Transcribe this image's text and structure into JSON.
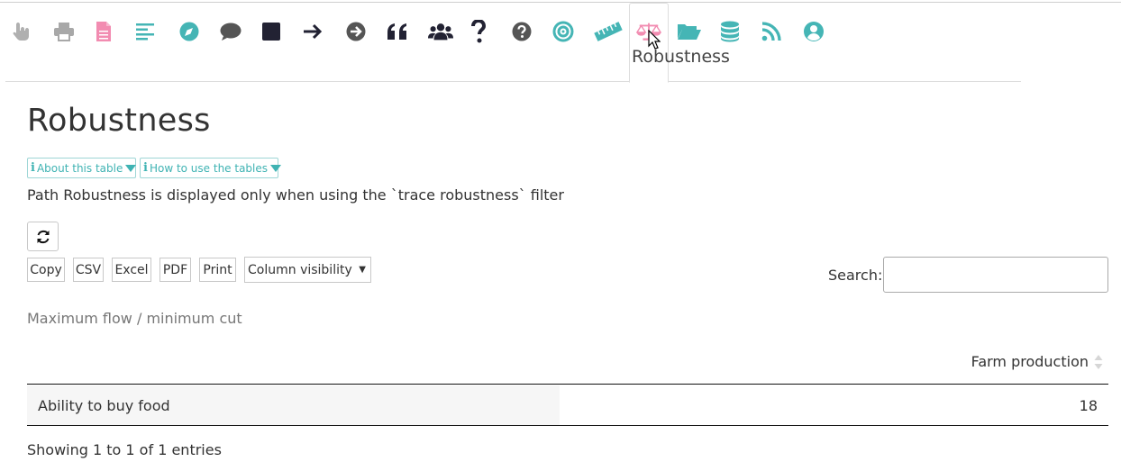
{
  "toolbar": {
    "icons": [
      {
        "name": "hand-pointer-icon",
        "color": "#b0b0b0"
      },
      {
        "name": "print-icon",
        "color": "#a8a8a8"
      },
      {
        "name": "file-icon",
        "color": "#f28cb1"
      },
      {
        "name": "align-left-icon",
        "color": "#45b5b5"
      },
      {
        "name": "compass-icon",
        "color": "#45b5b5"
      },
      {
        "name": "comment-icon",
        "color": "#555555"
      },
      {
        "name": "square-icon",
        "color": "#222233"
      },
      {
        "name": "arrow-right-icon",
        "color": "#222233"
      },
      {
        "name": "arrow-circle-right-icon",
        "color": "#555555"
      },
      {
        "name": "quote-left-icon",
        "color": "#222233"
      },
      {
        "name": "users-icon",
        "color": "#222233"
      },
      {
        "name": "question-icon",
        "color": "#222233"
      },
      {
        "name": "question-circle-icon",
        "color": "#555555"
      },
      {
        "name": "bullseye-icon",
        "color": "#45b5b5"
      },
      {
        "name": "ruler-icon",
        "color": "#45b5b5"
      },
      {
        "name": "balance-scale-icon",
        "color": "#f28cb1"
      },
      {
        "name": "folder-open-icon",
        "color": "#45b5b5"
      },
      {
        "name": "database-icon",
        "color": "#45b5b5"
      },
      {
        "name": "rss-icon",
        "color": "#45b5b5"
      },
      {
        "name": "user-circle-icon",
        "color": "#45b5b5"
      }
    ],
    "active_tab_label": "Robustness"
  },
  "page": {
    "title": "Robustness",
    "about_button": "About this table",
    "howto_button": "How to use the tables",
    "note": "Path Robustness is displayed only when using the `trace robustness` filter"
  },
  "controls": {
    "copy": "Copy",
    "csv": "CSV",
    "excel": "Excel",
    "pdf": "PDF",
    "print": "Print",
    "column_visibility": "Column visibility",
    "search_label": "Search:",
    "search_value": ""
  },
  "table": {
    "caption": "Maximum flow / minimum cut",
    "columns": [
      "",
      "Farm production"
    ],
    "rows": [
      {
        "label": "Ability to buy food",
        "value": "18"
      }
    ],
    "info": "Showing 1 to 1 of 1 entries"
  },
  "colors": {
    "accent": "#45b5b5",
    "pink": "#f28cb1"
  }
}
